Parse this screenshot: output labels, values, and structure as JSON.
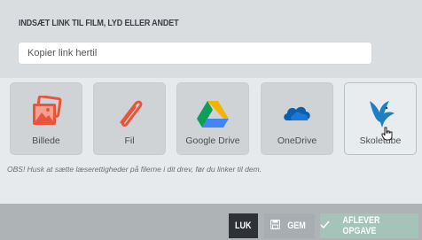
{
  "dialog": {
    "title": "INDSÆT LINK TIL FILM, LYD ELLER ANDET",
    "link_input": {
      "value": "",
      "placeholder": "Kopier link hertil"
    }
  },
  "sources": [
    {
      "label": "Billede",
      "icon": "image-icon"
    },
    {
      "label": "Fil",
      "icon": "paperclip-icon"
    },
    {
      "label": "Google Drive",
      "icon": "google-drive-icon"
    },
    {
      "label": "OneDrive",
      "icon": "onedrive-icon"
    },
    {
      "label": "Skoletube",
      "icon": "skoletube-bird-icon",
      "selected": true
    }
  ],
  "notice": "OBS! Husk at sætte læserettigheder på filerne i dit drev, før du linker til dem.",
  "footer": {
    "close_label": "LUK",
    "save_label": "GEM",
    "submit_label": "AFLEVER OPGAVE"
  },
  "colors": {
    "close_button": "#2f3338",
    "submit_button": "#a4c3b9",
    "accent_orange": "#e8553b"
  }
}
